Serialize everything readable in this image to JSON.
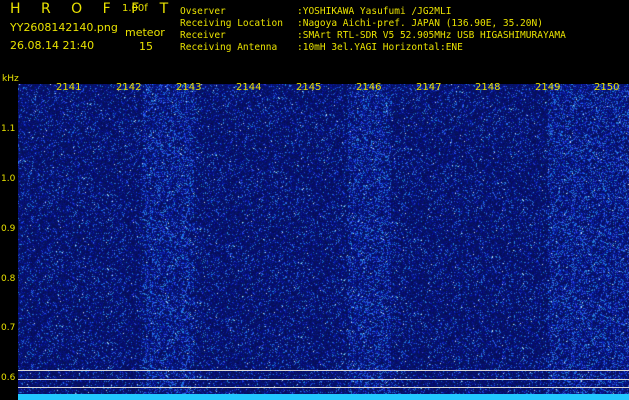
{
  "header": {
    "brand": "H R O F F T",
    "version": "1.00f",
    "filename": "YY2608142140.png",
    "datetime": "26.08.14 21:40",
    "meteor_label": "meteor",
    "meteor_count": "15"
  },
  "info": [
    {
      "key": "Ovserver",
      "value": ":YOSHIKAWA Yasufumi /JG2MLI"
    },
    {
      "key": "Receiving Location",
      "value": ":Nagoya Aichi-pref. JAPAN (136.90E, 35.20N)"
    },
    {
      "key": "Receiver",
      "value": ":SMArt RTL-SDR V5 52.905MHz USB HIGASHIMURAYAMA"
    },
    {
      "key": "Receiving Antenna",
      "value": ":10mH 3el.YAGI Horizontal:ENE"
    }
  ],
  "axes": {
    "y_unit": "kHz",
    "y_ticks": [
      "1.1",
      "1.0",
      "0.9",
      "0.8",
      "0.7",
      "0.6"
    ],
    "x_ticks": [
      "2141",
      "2142",
      "2143",
      "2144",
      "2145",
      "2146",
      "2147",
      "2148",
      "2149",
      "2150"
    ]
  },
  "colors": {
    "text": "#e9e200",
    "background": "#000000",
    "spectrum_base": "#0a1a8c",
    "level_bar": "#22c8ff",
    "marker_lines": "#d8d8d8"
  }
}
